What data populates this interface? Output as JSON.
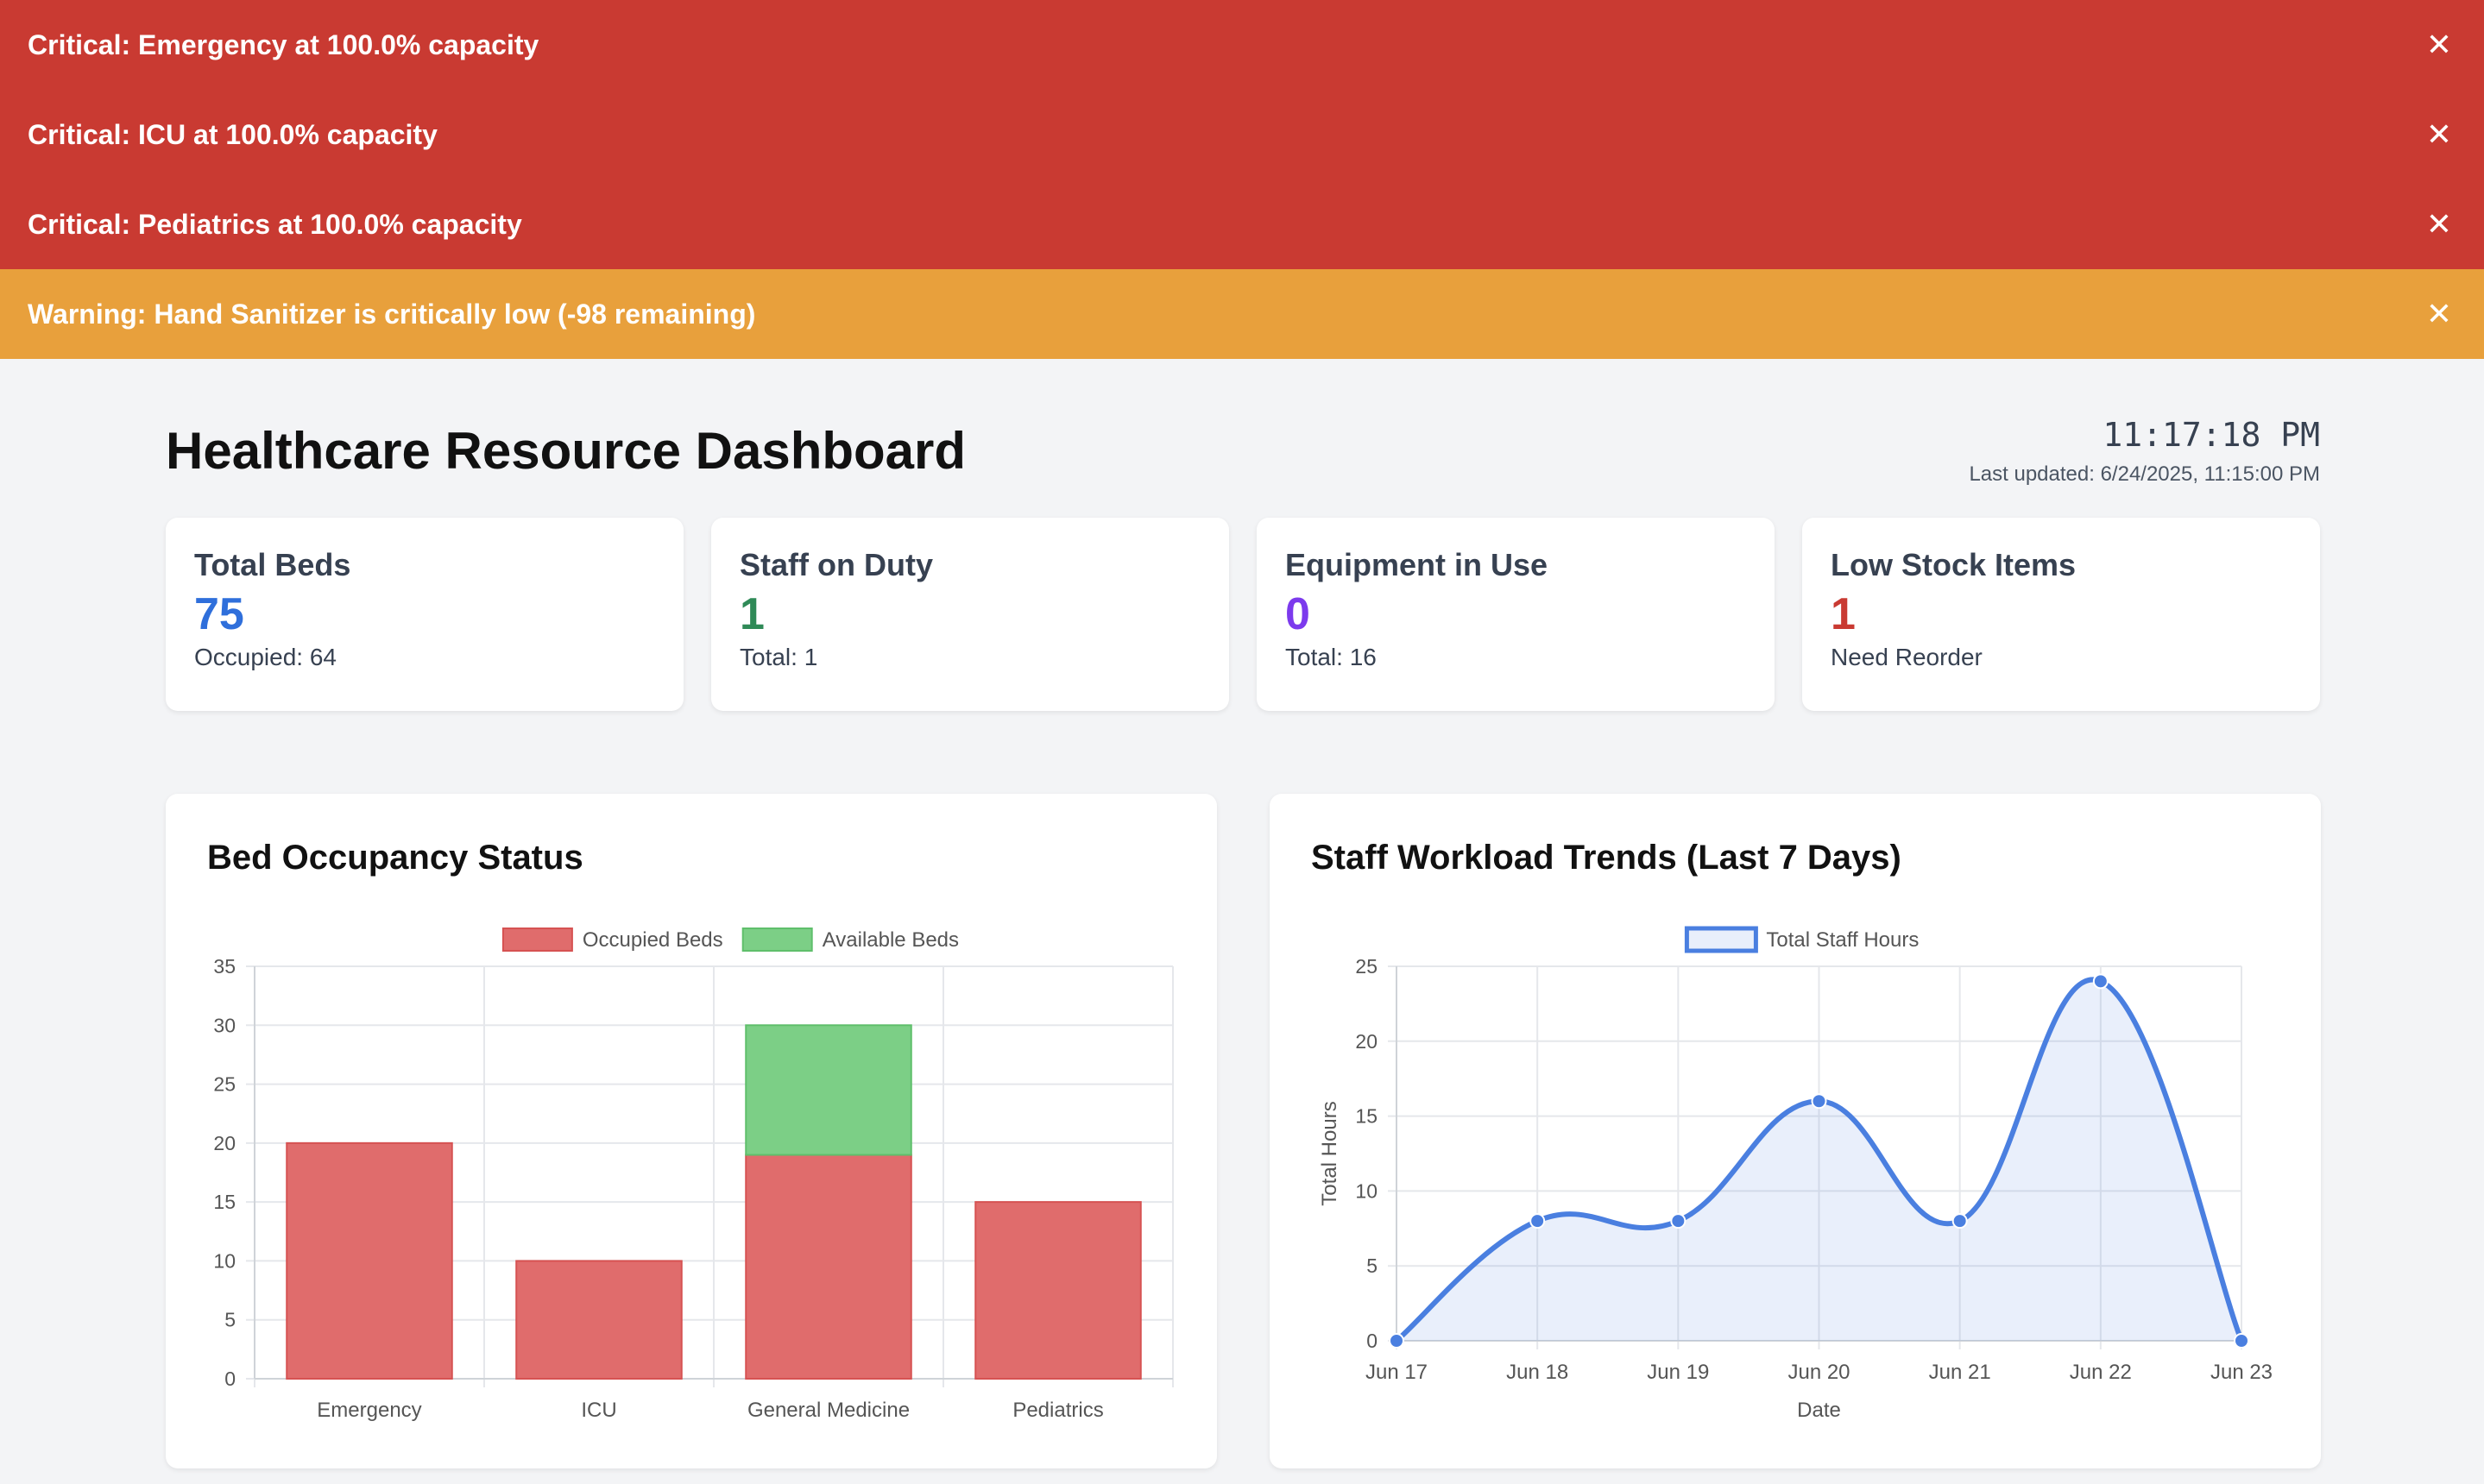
{
  "alerts": [
    {
      "type": "critical",
      "text": "Critical: Emergency at 100.0% capacity",
      "close": "✕"
    },
    {
      "type": "critical",
      "text": "Critical: ICU at 100.0% capacity",
      "close": "✕"
    },
    {
      "type": "critical",
      "text": "Critical: Pediatrics at 100.0% capacity",
      "close": "✕"
    },
    {
      "type": "warning",
      "text": "Warning: Hand Sanitizer is critically low (-98 remaining)",
      "close": "✕"
    }
  ],
  "colors": {
    "critical": "#c93a32",
    "warning": "#e8a03c"
  },
  "header": {
    "title": "Healthcare Resource Dashboard",
    "clock": "11:17:18 PM",
    "last_updated": "Last updated: 6/24/2025, 11:15:00 PM"
  },
  "stats": [
    {
      "title": "Total Beds",
      "value": "75",
      "sub": "Occupied: 64",
      "color": "#2f6fdb"
    },
    {
      "title": "Staff on Duty",
      "value": "1",
      "sub": "Total: 1",
      "color": "#2f8a57"
    },
    {
      "title": "Equipment in Use",
      "value": "0",
      "sub": "Total: 16",
      "color": "#7c3aed"
    },
    {
      "title": "Low Stock Items",
      "value": "1",
      "sub": "Need Reorder",
      "color": "#c93a32"
    }
  ],
  "chart_data": [
    {
      "type": "bar",
      "stacked": true,
      "title": "Bed Occupancy Status",
      "categories": [
        "Emergency",
        "ICU",
        "General Medicine",
        "Pediatrics"
      ],
      "series": [
        {
          "name": "Occupied Beds",
          "values": [
            20,
            10,
            19,
            15
          ],
          "color": "#e06c6c"
        },
        {
          "name": "Available Beds",
          "values": [
            0,
            0,
            11,
            0
          ],
          "color": "#7ccf86"
        }
      ],
      "ylim": [
        0,
        35
      ],
      "yticks": [
        0,
        5,
        10,
        15,
        20,
        25,
        30,
        35
      ],
      "legend": "top",
      "grid": true,
      "xlabel": "",
      "ylabel": ""
    },
    {
      "type": "area",
      "title": "Staff Workload Trends (Last 7 Days)",
      "x": [
        "Jun 17",
        "Jun 18",
        "Jun 19",
        "Jun 20",
        "Jun 21",
        "Jun 22",
        "Jun 23"
      ],
      "series": [
        {
          "name": "Total Staff Hours",
          "values": [
            0,
            8,
            8,
            16,
            8,
            24,
            0
          ],
          "color": "#4a7fe0"
        }
      ],
      "ylim": [
        0,
        25
      ],
      "yticks": [
        0,
        5,
        10,
        15,
        20,
        25
      ],
      "xlabel": "Date",
      "ylabel": "Total Hours",
      "legend": "top",
      "grid": true
    }
  ]
}
